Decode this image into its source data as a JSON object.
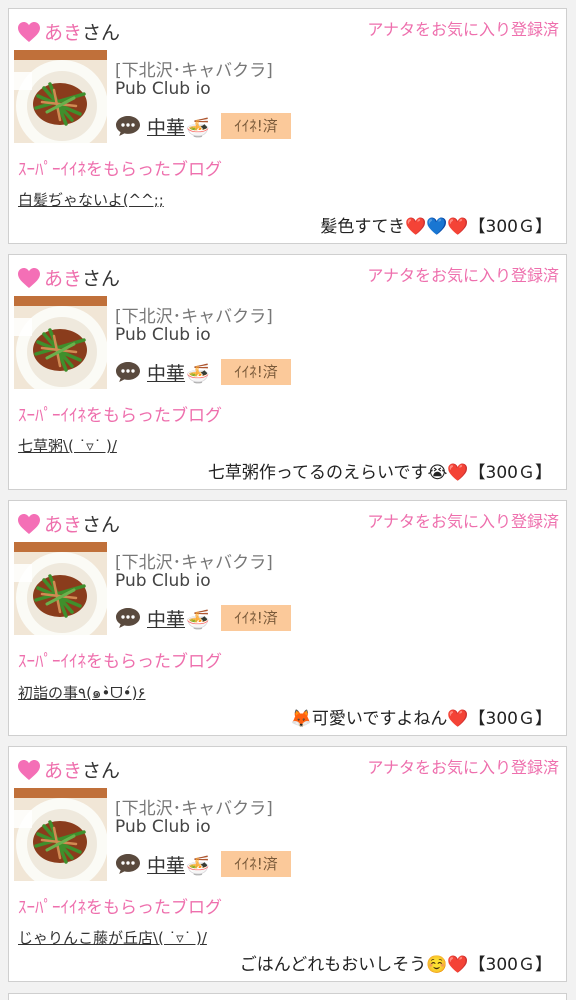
{
  "colors": {
    "accent_pink": "#ee6fad",
    "badge_orange": "#fbc99a",
    "heart_pink": "#f46fb6"
  },
  "icons": {
    "user_heart": "pink-heart-icon",
    "comment": "speech-bubble-icon",
    "genre_emoji": "noodle-bowl-emoji"
  },
  "posts": [
    {
      "user_name": "あき",
      "user_suffix": "さん",
      "favorite_status": "アナタをお気に入り登録済",
      "shop_area": "[下北沢･キャバクラ]",
      "shop_name": "Pub Club io",
      "genre": "中華",
      "genre_emoji": "🍜",
      "iine_badge": "ｲｲﾈ!済",
      "section_label": "ｽｰﾊﾟｰｲｲﾈをもらったブログ",
      "blog_title": "白髪ぢゃないよ(^^;;",
      "comment": "髪色すてき❤️💙❤️",
      "reward": "【300Ｇ】"
    },
    {
      "user_name": "あき",
      "user_suffix": "さん",
      "favorite_status": "アナタをお気に入り登録済",
      "shop_area": "[下北沢･キャバクラ]",
      "shop_name": "Pub Club io",
      "genre": "中華",
      "genre_emoji": "🍜",
      "iine_badge": "ｲｲﾈ!済",
      "section_label": "ｽｰﾊﾟｰｲｲﾈをもらったブログ",
      "blog_title": "七草粥\\(  ˙▿˙  )/",
      "comment": "七草粥作ってるのえらいです😭❤️",
      "reward": "【300Ｇ】"
    },
    {
      "user_name": "あき",
      "user_suffix": "さん",
      "favorite_status": "アナタをお気に入り登録済",
      "shop_area": "[下北沢･キャバクラ]",
      "shop_name": "Pub Club io",
      "genre": "中華",
      "genre_emoji": "🍜",
      "iine_badge": "ｲｲﾈ!済",
      "section_label": "ｽｰﾊﾟｰｲｲﾈをもらったブログ",
      "blog_title": "初詣の事٩(๑•̀ᗜ•́)۶",
      "comment": "🦊可愛いですよねん❤️",
      "reward": "【300Ｇ】"
    },
    {
      "user_name": "あき",
      "user_suffix": "さん",
      "favorite_status": "アナタをお気に入り登録済",
      "shop_area": "[下北沢･キャバクラ]",
      "shop_name": "Pub Club io",
      "genre": "中華",
      "genre_emoji": "🍜",
      "iine_badge": "ｲｲﾈ!済",
      "section_label": "ｽｰﾊﾟｰｲｲﾈをもらったブログ",
      "blog_title": "じゃりんこ藤が丘店\\(  ˙▿˙  )/",
      "comment": "ごはんどれもおいしそう☺️❤️",
      "reward": "【300Ｇ】"
    }
  ]
}
